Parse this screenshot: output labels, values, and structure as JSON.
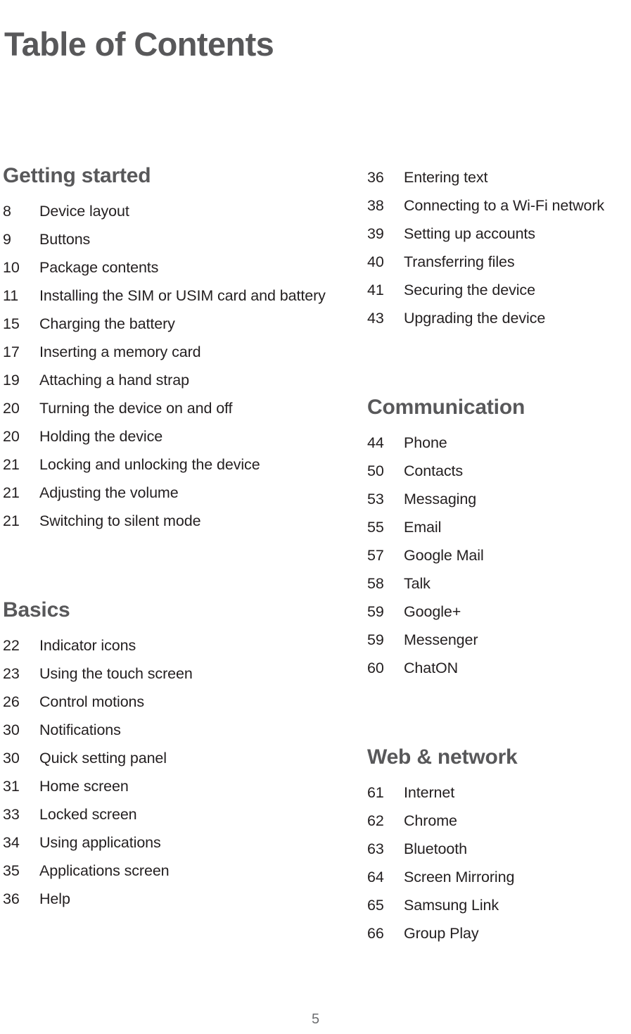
{
  "document": {
    "title": "Table of Contents",
    "page_number": "5",
    "text_color": "#231f20",
    "heading_color": "#58585a",
    "folio_color": "#6d6e71",
    "background": "#ffffff"
  },
  "columns": [
    {
      "name": "left",
      "sections": [
        {
          "heading": "Getting started",
          "has_heading": true,
          "entries": [
            {
              "page": "8",
              "title": "Device layout"
            },
            {
              "page": "9",
              "title": "Buttons"
            },
            {
              "page": "10",
              "title": "Package contents"
            },
            {
              "page": "11",
              "title": "Installing the SIM or USIM card and battery"
            },
            {
              "page": "15",
              "title": "Charging the battery"
            },
            {
              "page": "17",
              "title": "Inserting a memory card"
            },
            {
              "page": "19",
              "title": "Attaching a hand strap"
            },
            {
              "page": "20",
              "title": "Turning the device on and off"
            },
            {
              "page": "20",
              "title": "Holding the device"
            },
            {
              "page": "21",
              "title": "Locking and unlocking the device"
            },
            {
              "page": "21",
              "title": "Adjusting the volume"
            },
            {
              "page": "21",
              "title": "Switching to silent mode"
            }
          ]
        },
        {
          "heading": "Basics",
          "has_heading": true,
          "entries": [
            {
              "page": "22",
              "title": "Indicator icons"
            },
            {
              "page": "23",
              "title": "Using the touch screen"
            },
            {
              "page": "26",
              "title": "Control motions"
            },
            {
              "page": "30",
              "title": "Notifications"
            },
            {
              "page": "30",
              "title": "Quick setting panel"
            },
            {
              "page": "31",
              "title": "Home screen"
            },
            {
              "page": "33",
              "title": "Locked screen"
            },
            {
              "page": "34",
              "title": "Using applications"
            },
            {
              "page": "35",
              "title": "Applications screen"
            },
            {
              "page": "36",
              "title": "Help"
            }
          ]
        }
      ]
    },
    {
      "name": "right",
      "sections": [
        {
          "heading": "",
          "has_heading": false,
          "entries": [
            {
              "page": "36",
              "title": "Entering text"
            },
            {
              "page": "38",
              "title": "Connecting to a Wi-Fi network"
            },
            {
              "page": "39",
              "title": "Setting up accounts"
            },
            {
              "page": "40",
              "title": "Transferring files"
            },
            {
              "page": "41",
              "title": "Securing the device"
            },
            {
              "page": "43",
              "title": "Upgrading the device"
            }
          ]
        },
        {
          "heading": "Communication",
          "has_heading": true,
          "entries": [
            {
              "page": "44",
              "title": "Phone"
            },
            {
              "page": "50",
              "title": "Contacts"
            },
            {
              "page": "53",
              "title": "Messaging"
            },
            {
              "page": "55",
              "title": "Email"
            },
            {
              "page": "57",
              "title": "Google Mail"
            },
            {
              "page": "58",
              "title": "Talk"
            },
            {
              "page": "59",
              "title": "Google+"
            },
            {
              "page": "59",
              "title": "Messenger"
            },
            {
              "page": "60",
              "title": "ChatON"
            }
          ]
        },
        {
          "heading": "Web & network",
          "has_heading": true,
          "entries": [
            {
              "page": "61",
              "title": "Internet"
            },
            {
              "page": "62",
              "title": "Chrome"
            },
            {
              "page": "63",
              "title": "Bluetooth"
            },
            {
              "page": "64",
              "title": "Screen Mirroring"
            },
            {
              "page": "65",
              "title": "Samsung Link"
            },
            {
              "page": "66",
              "title": "Group Play"
            }
          ]
        }
      ]
    }
  ]
}
